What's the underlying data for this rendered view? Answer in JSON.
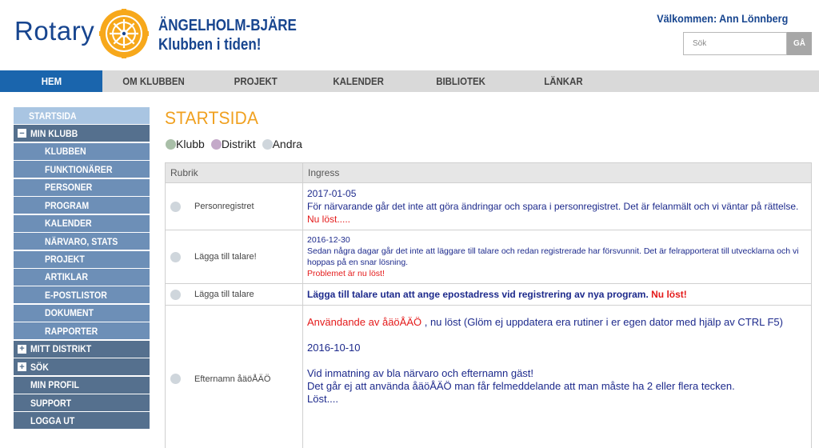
{
  "header": {
    "logo_text": "Rotary",
    "logo_wheel_text": "ROTARY INTERNATIONAL",
    "club_name_line1": "ÄNGELHOLM-BJÄRE",
    "club_name_line2": "Klubben i tiden!",
    "welcome": "Välkommen: Ann Lönnberg",
    "search_placeholder": "Sök",
    "search_button": "GÅ"
  },
  "nav": {
    "items": [
      {
        "label": "HEM",
        "active": true
      },
      {
        "label": "OM KLUBBEN"
      },
      {
        "label": "PROJEKT"
      },
      {
        "label": "KALENDER"
      },
      {
        "label": "BIBLIOTEK"
      },
      {
        "label": "LÄNKAR"
      }
    ]
  },
  "sidebar": {
    "items": [
      {
        "label": "STARTSIDA"
      },
      {
        "label": "MIN KLUBB",
        "toggle": "−"
      },
      {
        "label": "KLUBBEN"
      },
      {
        "label": "FUNKTIONÄRER"
      },
      {
        "label": "PERSONER"
      },
      {
        "label": "PROGRAM"
      },
      {
        "label": "KALENDER"
      },
      {
        "label": "NÄRVARO, STATS"
      },
      {
        "label": "PROJEKT"
      },
      {
        "label": "ARTIKLAR"
      },
      {
        "label": "E-POSTLISTOR"
      },
      {
        "label": "DOKUMENT"
      },
      {
        "label": "RAPPORTER"
      },
      {
        "label": "MITT DISTRIKT",
        "toggle": "+"
      },
      {
        "label": "SÖK",
        "toggle": "+"
      },
      {
        "label": "MIN PROFIL"
      },
      {
        "label": "SUPPORT"
      },
      {
        "label": "LOGGA UT"
      }
    ]
  },
  "main": {
    "title": "STARTSIDA",
    "filters": [
      {
        "label": "Klubb",
        "color": "#a9bfa8"
      },
      {
        "label": "Distrikt",
        "color": "#c4a9c9"
      },
      {
        "label": "Andra",
        "color": "#cfd6dc"
      }
    ],
    "table": {
      "headers": [
        "Rubrik",
        "Ingress"
      ],
      "rows": [
        {
          "rubrik": "Personregistret",
          "date": "2017-01-05",
          "text": "För närvarande går det inte att göra ändringar och spara i personregistret. Det är felanmält och vi väntar på rättelse.",
          "status": "Nu löst....."
        },
        {
          "rubrik": "Lägga till talare!",
          "date": "2016-12-30",
          "text": "Sedan några dagar går det inte att läggare till talare och redan registrerade har försvunnit.  Det är felrapporterat till utvecklarna och vi hoppas på en snar lösning.",
          "status": "Problemet är nu löst!"
        },
        {
          "rubrik": "Lägga till talare",
          "text": "Lägga till talare utan att ange epostadress vid registrering av nya program.",
          "status": "Nu löst!"
        },
        {
          "rubrik": "Efternamn åäöÅÄÖ",
          "red_lead": "Användande av åäöÅÄÖ",
          "line1_rest": " , nu löst (Glöm ej uppdatera era rutiner i er egen dator med hjälp av CTRL F5)",
          "date": "2016-10-10",
          "line3": "Vid inmatning av bla närvaro och efternamn gäst!",
          "line4": "Det går ej att använda åäöÅÄÖ man får felmeddelande att man måste ha 2 eller flera tecken.",
          "line5": "Löst...."
        }
      ]
    }
  }
}
